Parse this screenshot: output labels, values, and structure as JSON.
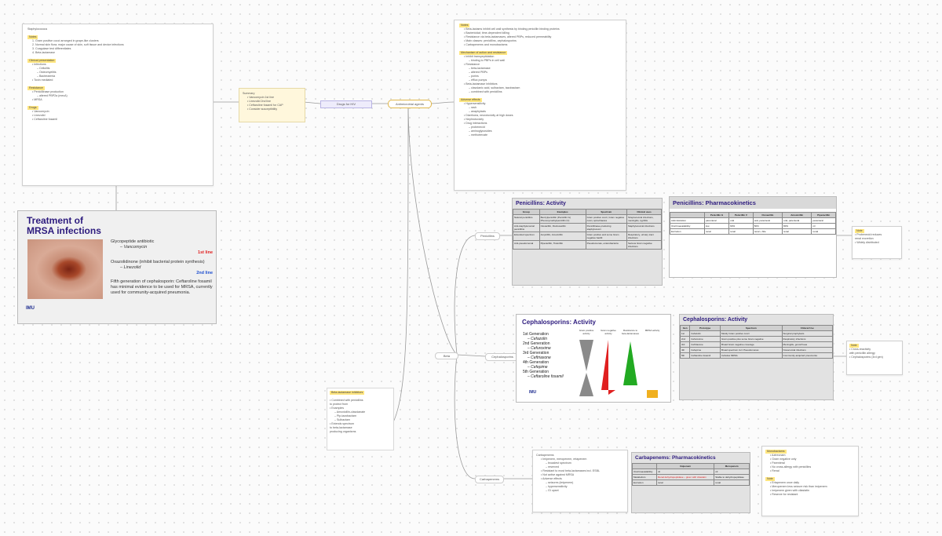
{
  "canvas": {
    "background": "#fbfbfb"
  },
  "nodes": {
    "root": "Drugs for HIV",
    "agents": "Antimicrobial agents",
    "penicillins": "Penicillins",
    "cephalosporins": "Cephalosporins",
    "carbapenems": "Carbapenems",
    "branch_small": "Beta"
  },
  "mrsa_slide": {
    "title_line1": "Treatment of",
    "title_line2": "MRSA infections",
    "b1": "Glycopeptide antibiotic",
    "b1_sub": "– Vancomycin",
    "b1_tag": "1st line",
    "b2": "Oxazolidinone  (inhibit bacterial protein synthesis)",
    "b2_sub": "– Linezolid",
    "b2_tag": "2nd line",
    "b3": "Fifth generation of cephalosporin: Ceftaroline fosamil has minimal evidence to be used for MRSA, currently used for community-acquired pneumonia.",
    "logo": "IMU"
  },
  "pen_activity": {
    "title": "Penicillins: Activity",
    "headers": [
      "Group",
      "Examples",
      "Spectrum",
      "Clinical uses"
    ],
    "rows": [
      [
        "Natural penicillins",
        "Benzylpenicillin (Penicillin G) Phenoxymethylpenicillin (V)",
        "Gram positive cocci, Gram negative cocci, spirochaetes",
        "Streptococcal infections, meningitis, syphilis"
      ],
      [
        "Anti-staphylococcal penicillins",
        "Cloxacillin, Flucloxacillin",
        "Penicillinase-producing staphylococci",
        "Staphylococcal infections"
      ],
      [
        "Extended spectrum",
        "Ampicillin, Amoxicillin",
        "Gram positive and some Gram negative bacilli",
        "Respiratory, urinary tract infections"
      ],
      [
        "Anti-pseudomonal",
        "Piperacillin, Ticarcillin",
        "Pseudomonas, enterobacteria",
        "Serious Gram negative infections"
      ]
    ]
  },
  "pen_pk": {
    "title": "Penicillins: Pharmacokinetics",
    "headers": [
      "",
      "Penicillin G",
      "Penicillin V",
      "Cloxacillin",
      "Amoxicillin",
      "Piperacillin"
    ],
    "rows": [
      [
        "Administration",
        "parenteral",
        "oral",
        "oral, parenteral",
        "oral, parenteral",
        "parenteral"
      ],
      [
        "Oral bioavailability",
        "low",
        "60%",
        "50%",
        "80%",
        "nil"
      ],
      [
        "Excretion",
        "renal",
        "renal",
        "renal + bile",
        "renal",
        "renal"
      ]
    ]
  },
  "ceph_activity": {
    "title": "Cephalosporins: Activity",
    "generations": [
      "1st Generation",
      "– Cefazolin",
      "2nd Generation",
      "– Cefuroxime",
      "3rd Generation",
      "– Ceftriaxone",
      "4th Generation",
      "– Cefepime",
      "5th Generation",
      "– Ceftaroline fosamil"
    ],
    "col_labels": [
      "Gram positive activity",
      "Gram negative activity",
      "Resistance to beta-lactamases",
      "MRSA activity"
    ],
    "logo": "IMU"
  },
  "ceph_table": {
    "title": "Cephalosporins: Activity",
    "headers": [
      "Gen",
      "Prototype",
      "Spectrum",
      "Clinical Use"
    ],
    "rows": [
      [
        "1st",
        "Cefazolin",
        "Mostly Gram positive cocci",
        "Surgical prophylaxis"
      ],
      [
        "2nd",
        "Cefuroxime",
        "Gram positive plus some Gram negative",
        "Respiratory infections"
      ],
      [
        "3rd",
        "Ceftriaxone",
        "Broad Gram negative coverage",
        "Meningitis, gonorrhoea"
      ],
      [
        "4th",
        "Cefepime",
        "Broad spectrum incl. Pseudomonas",
        "Nosocomial infections"
      ],
      [
        "5th",
        "Ceftaroline fosamil",
        "Includes MRSA",
        "Community-acquired pneumonia"
      ]
    ]
  },
  "carb_pk": {
    "title": "Carbapenems: Pharmacokinetics",
    "headers": [
      "",
      "Imipenem",
      "Meropenem"
    ],
    "rows": [
      [
        "Oral bioavailability",
        "nil",
        "nil"
      ],
      [
        "Metabolism",
        "Renal dehydropeptidase – given with cilastatin",
        "Stable to dehydropeptidase"
      ],
      [
        "Excretion",
        "renal",
        "renal"
      ]
    ]
  },
  "colors": {
    "accent": "#2d1b7e",
    "note_yellow": "#fff7dc",
    "highlight": "#ffe680",
    "red": "#e02020",
    "green": "#22aa22",
    "grey": "#888888"
  }
}
